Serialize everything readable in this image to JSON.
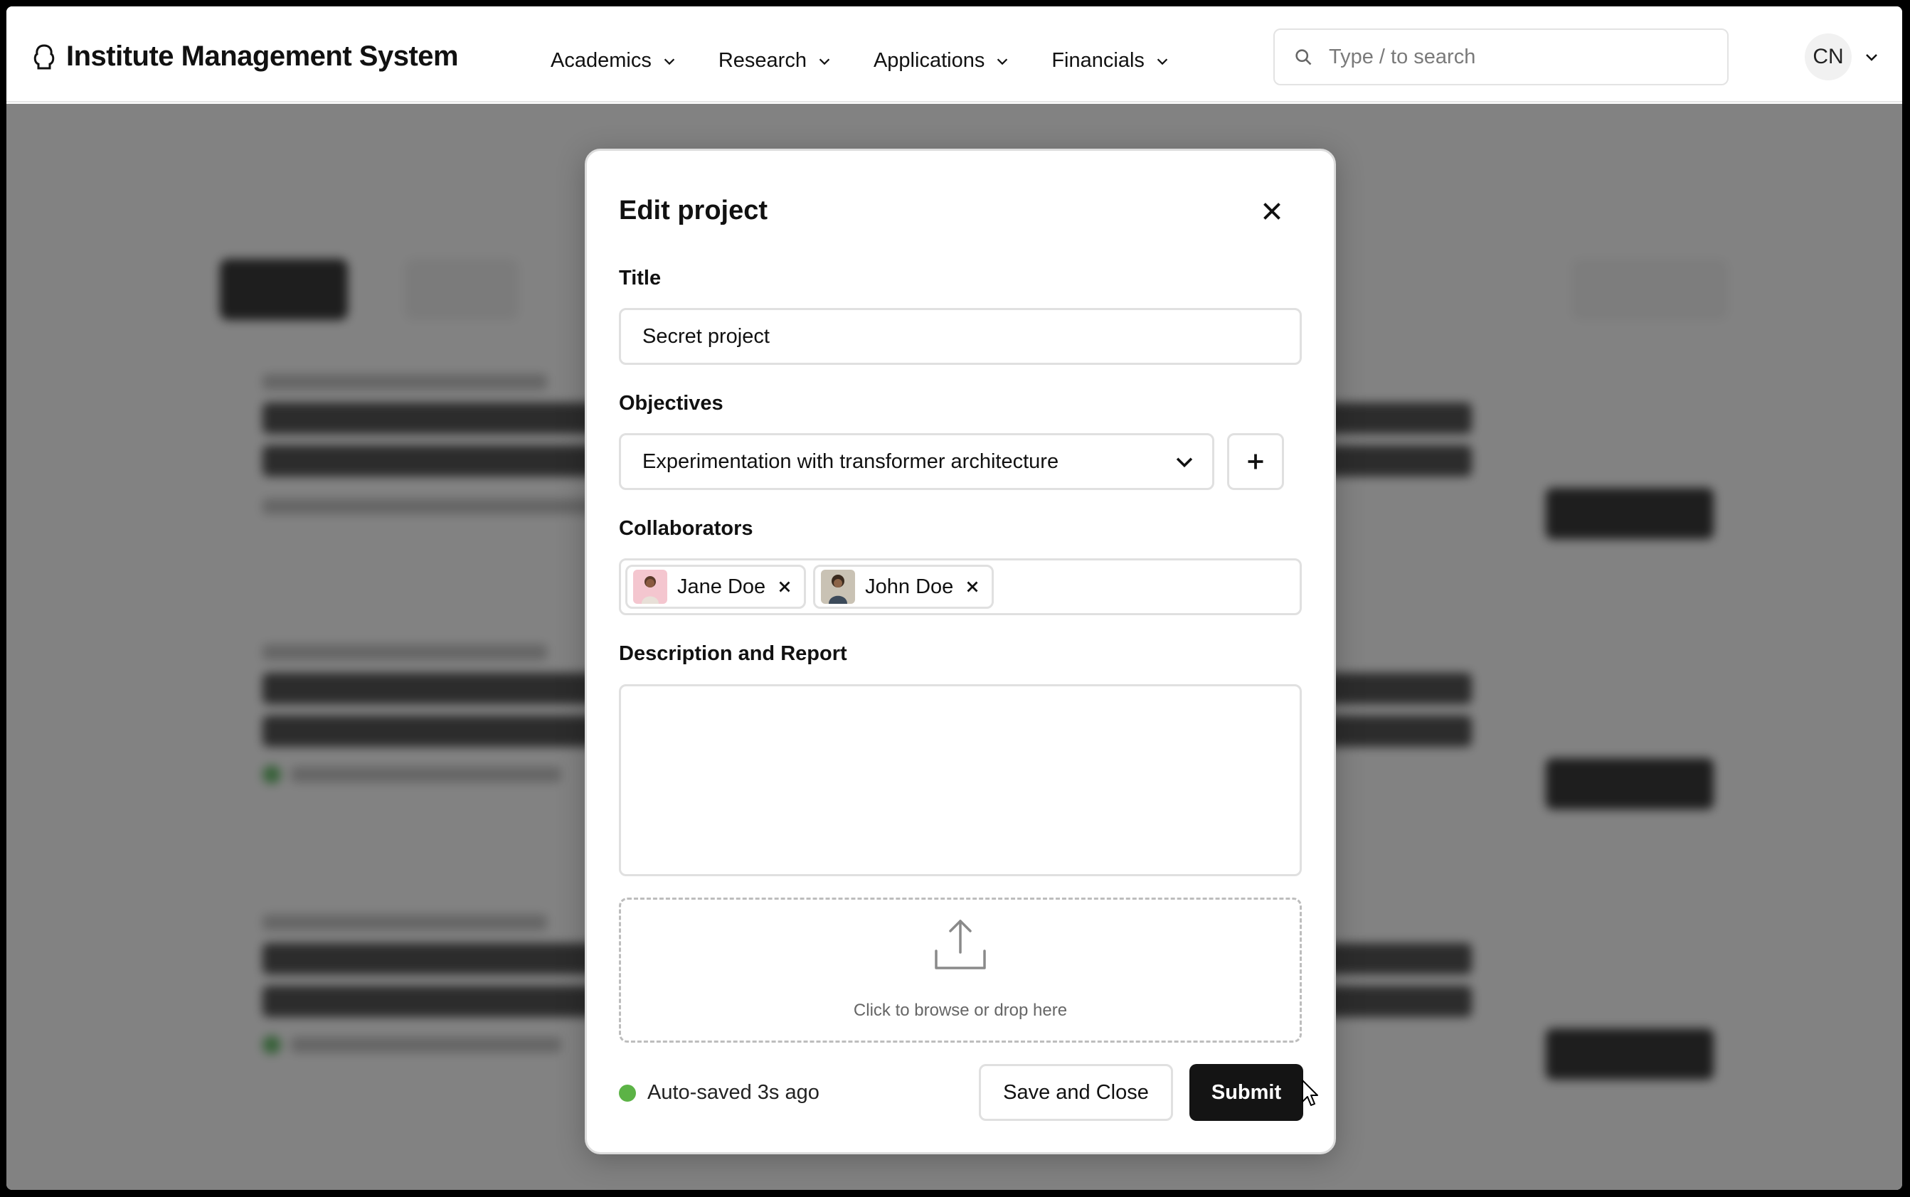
{
  "header": {
    "brand_title": "Institute Management System",
    "nav": [
      {
        "label": "Academics"
      },
      {
        "label": "Research"
      },
      {
        "label": "Applications"
      },
      {
        "label": "Financials"
      }
    ],
    "search_placeholder": "Type / to search",
    "user_initials": "CN"
  },
  "modal": {
    "title": "Edit project",
    "title_label": "Title",
    "title_value": "Secret project",
    "objectives_label": "Objectives",
    "objectives_selected": "Experimentation with transformer architecture",
    "collaborators_label": "Collaborators",
    "collaborators": [
      {
        "name": "Jane Doe"
      },
      {
        "name": "John Doe"
      }
    ],
    "description_label": "Description and Report",
    "description_value": "",
    "dropzone_text": "Click to browse or drop here",
    "autosave_text": "Auto-saved 3s ago",
    "save_close_label": "Save and Close",
    "submit_label": "Submit"
  },
  "colors": {
    "primary_button": "#141414",
    "status_green": "#5cb346",
    "overlay": "rgba(40,40,40,0.58)"
  },
  "icons": {
    "brand": "brand-logo-icon",
    "search": "search-icon",
    "close": "close-icon",
    "dropdown": "chevron-down-icon",
    "add": "plus-icon",
    "remove": "x-icon",
    "upload": "upload-icon"
  }
}
